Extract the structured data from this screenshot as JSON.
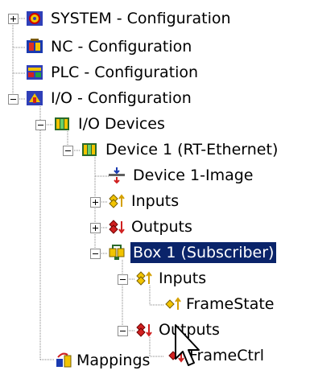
{
  "tree": {
    "system": {
      "label": "SYSTEM - Configuration",
      "icon": "system-config-icon"
    },
    "nc": {
      "label": "NC - Configuration",
      "icon": "nc-config-icon"
    },
    "plc": {
      "label": "PLC - Configuration",
      "icon": "plc-config-icon"
    },
    "io": {
      "label": "I/O - Configuration",
      "icon": "io-config-icon"
    },
    "io_devices": {
      "label": "I/O Devices",
      "icon": "io-devices-icon"
    },
    "device1": {
      "label": "Device 1 (RT-Ethernet)",
      "icon": "ethernet-device-icon"
    },
    "device1_image": {
      "label": "Device 1-Image",
      "icon": "process-image-icon"
    },
    "dev_inputs": {
      "label": "Inputs",
      "icon": "inputs-icon"
    },
    "dev_outputs": {
      "label": "Outputs",
      "icon": "outputs-icon"
    },
    "box1": {
      "label": "Box 1 (Subscriber)",
      "icon": "box-subscriber-icon",
      "selected": true
    },
    "box_inputs": {
      "label": "Inputs",
      "icon": "inputs-icon"
    },
    "framestate": {
      "label": "FrameState",
      "icon": "input-variable-icon"
    },
    "box_outputs": {
      "label": "Outputs",
      "icon": "outputs-icon"
    },
    "framectrl": {
      "label": "FrameCtrl",
      "icon": "output-variable-icon"
    },
    "mappings": {
      "label": "Mappings",
      "icon": "mappings-icon"
    }
  },
  "colors": {
    "selection_bg": "#0a246a",
    "selection_fg": "#ffffff",
    "tree_line": "#808080"
  },
  "cursor": {
    "icon": "mouse-pointer-icon"
  }
}
